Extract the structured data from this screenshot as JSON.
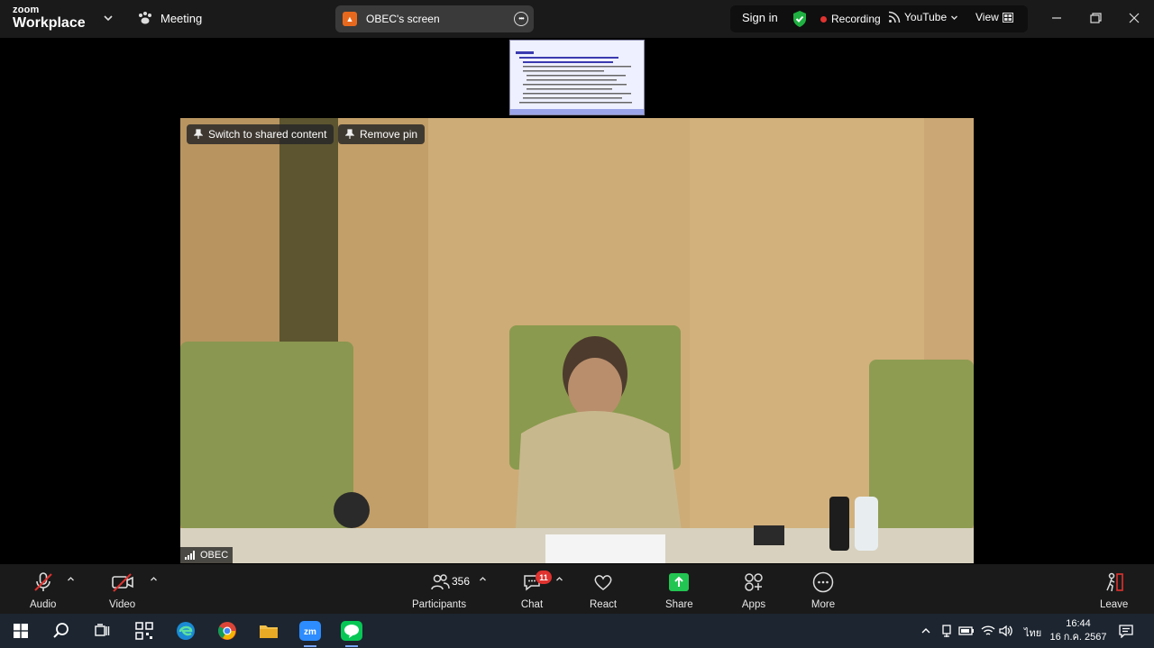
{
  "app": {
    "brand_top": "zoom",
    "brand_bottom": "Workplace",
    "meeting_label": "Meeting"
  },
  "screen_share": {
    "label": "OBEC's screen"
  },
  "header": {
    "sign_in": "Sign in",
    "recording": "Recording",
    "youtube": "YouTube",
    "view": "View"
  },
  "video": {
    "switch_label": "Switch to shared content",
    "remove_pin_label": "Remove pin",
    "speaker_name": "OBEC"
  },
  "toolbar": {
    "audio": "Audio",
    "video": "Video",
    "participants": "Participants",
    "participants_count": "356",
    "chat": "Chat",
    "chat_badge": "11",
    "react": "React",
    "share": "Share",
    "apps": "Apps",
    "more": "More",
    "leave": "Leave"
  },
  "taskbar": {
    "lang": "ไทย",
    "time": "16:44",
    "date": "16 ก.ค. 2567"
  },
  "colors": {
    "share_green": "#23c552",
    "rec_red": "#e0322f",
    "shield_green": "#1fb141",
    "leave_red": "#e0322f"
  }
}
